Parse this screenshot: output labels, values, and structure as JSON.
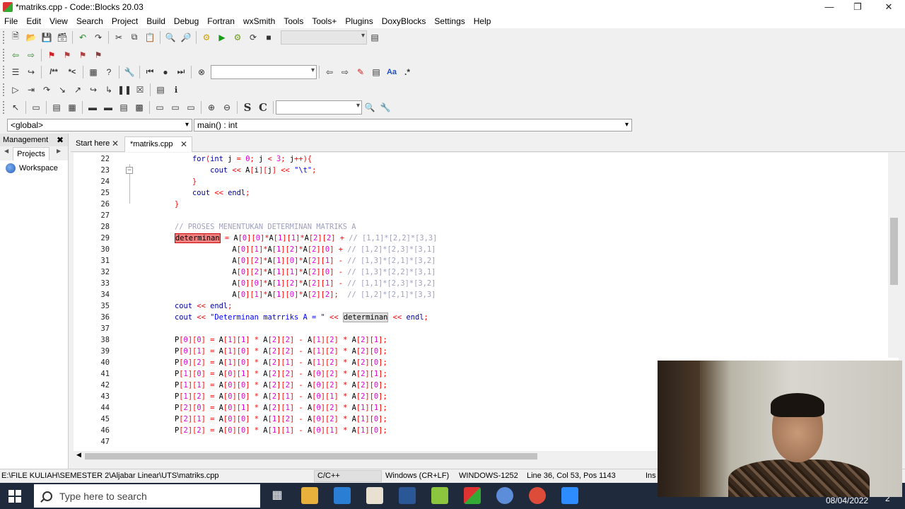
{
  "window": {
    "title": "*matriks.cpp - Code::Blocks 20.03"
  },
  "menu": [
    "File",
    "Edit",
    "View",
    "Search",
    "Project",
    "Build",
    "Debug",
    "Fortran",
    "wxSmith",
    "Tools",
    "Tools+",
    "Plugins",
    "DoxyBlocks",
    "Settings",
    "Help"
  ],
  "scope": {
    "global": "<global>",
    "function": "main() : int"
  },
  "management": {
    "title": "Management",
    "tab": "Projects",
    "workspace": "Workspace"
  },
  "editor_tabs": [
    {
      "label": "Start here"
    },
    {
      "label": "*matriks.cpp",
      "active": true
    }
  ],
  "code_lines": [
    {
      "n": "22",
      "t": "        for(int j = 0; j < 3; j++){"
    },
    {
      "n": "23",
      "t": "            cout << A[i][j] << \"\\t\";"
    },
    {
      "n": "24",
      "t": "        }"
    },
    {
      "n": "25",
      "t": "        cout << endl;"
    },
    {
      "n": "26",
      "t": "    }"
    },
    {
      "n": "27",
      "t": ""
    },
    {
      "n": "28",
      "t": "    // PROSES MENENTUKAN DETERMINAN MATRIKS A"
    },
    {
      "n": "29",
      "t": "    determinan = A[0][0]*A[1][1]*A[2][2] + // [1,1]*[2,2]*[3,3]"
    },
    {
      "n": "30",
      "t": "                 A[0][1]*A[1][2]*A[2][0] + // [1,2]*[2,3]*[3,1]"
    },
    {
      "n": "31",
      "t": "                 A[0][2]*A[1][0]*A[2][1] - // [1,3]*[2,1]*[3,2]"
    },
    {
      "n": "32",
      "t": "                 A[0][2]*A[1][1]*A[2][0] - // [1,3]*[2,2]*[3,1]"
    },
    {
      "n": "33",
      "t": "                 A[0][0]*A[1][2]*A[2][1] - // [1,1]*[2,3]*[3,2]"
    },
    {
      "n": "34",
      "t": "                 A[0][1]*A[1][0]*A[2][2];  // [1,2]*[2,1]*[3,3]"
    },
    {
      "n": "35",
      "t": "    cout << endl;"
    },
    {
      "n": "36",
      "t": "    cout << \"Determinan matrriks A = \" << determinan << endl;"
    },
    {
      "n": "37",
      "t": ""
    },
    {
      "n": "38",
      "t": "    P[0][0] = A[1][1] * A[2][2] - A[1][2] * A[2][1];"
    },
    {
      "n": "39",
      "t": "    P[0][1] = A[1][0] * A[2][2] - A[1][2] * A[2][0];"
    },
    {
      "n": "40",
      "t": "    P[0][2] = A[1][0] * A[2][1] - A[1][2] * A[2][0];"
    },
    {
      "n": "41",
      "t": "    P[1][0] = A[0][1] * A[2][2] - A[0][2] * A[2][1];"
    },
    {
      "n": "42",
      "t": "    P[1][1] = A[0][0] * A[2][2] - A[0][2] * A[2][0];"
    },
    {
      "n": "43",
      "t": "    P[1][2] = A[0][0] * A[2][1] - A[0][1] * A[2][0];"
    },
    {
      "n": "44",
      "t": "    P[2][0] = A[0][1] * A[2][1] - A[0][2] * A[1][1];"
    },
    {
      "n": "45",
      "t": "    P[2][1] = A[0][0] * A[1][2] - A[0][2] * A[1][0];"
    },
    {
      "n": "46",
      "t": "    P[2][2] = A[0][0] * A[1][1] - A[0][1] * A[1][0];"
    },
    {
      "n": "47",
      "t": ""
    }
  ],
  "status": {
    "path": "E:\\FILE KULIAH\\SEMESTER 2\\Aljabar Linear\\UTS\\matriks.cpp",
    "lang": "C/C++",
    "eol": "Windows (CR+LF)",
    "encoding": "WINDOWS-1252",
    "position": "Line 36, Col 53, Pos 1143",
    "mode": "Ins"
  },
  "taskbar": {
    "search_placeholder": "Type here to search",
    "date": "08/04/2022",
    "notifications": "2"
  },
  "colors": {
    "keyword": "#0000a0",
    "string": "#0000ff",
    "comment": "#a0a0c0",
    "number": "#e000e0",
    "operator": "#ff0000",
    "taskbar": "#1f2a3d"
  }
}
